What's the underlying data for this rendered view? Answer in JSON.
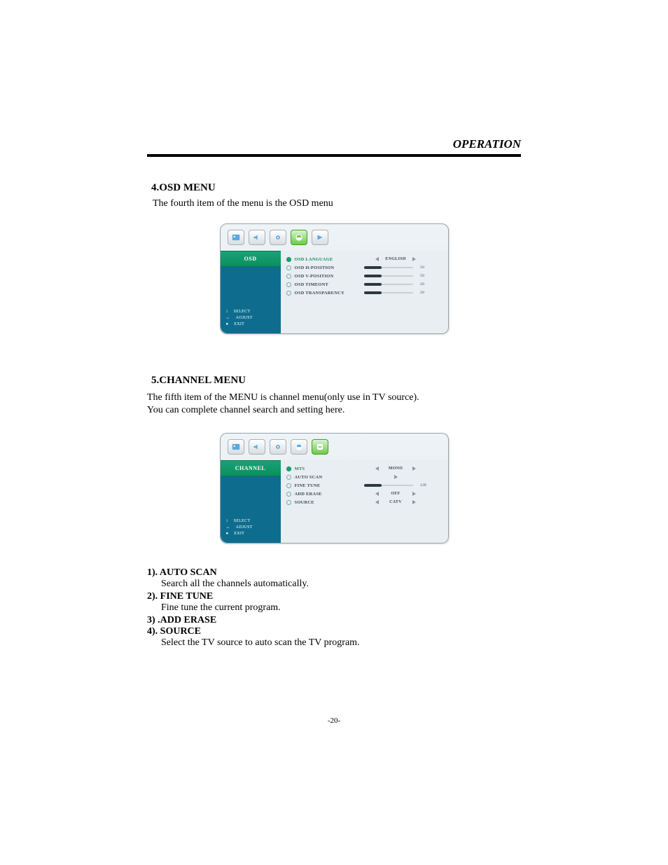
{
  "header": {
    "title": "OPERATION"
  },
  "page_number": "-20-",
  "section4": {
    "title": "4.OSD MENU",
    "text": "The fourth item of the menu is the OSD menu",
    "menu": {
      "side_title": "OSD",
      "hints": [
        "SELECT",
        "AOJUST",
        "EXIT"
      ],
      "items": [
        {
          "label": "OSD  LANGUAGE",
          "type": "enum",
          "value": "ENGLISH",
          "selected": true
        },
        {
          "label": "OSD  H-POSITION",
          "type": "slider",
          "value": "50"
        },
        {
          "label": "OSD  V-POSITION",
          "type": "slider",
          "value": "50"
        },
        {
          "label": "OSD  TIMEONT",
          "type": "slider",
          "value": "20"
        },
        {
          "label": "OSD  TRANSPARENCY",
          "type": "slider",
          "value": "20"
        }
      ]
    }
  },
  "section5": {
    "title": "5.CHANNEL MENU",
    "para1": "The fifth item of the MENU is channel menu(only use in TV source).",
    "para2": "You can complete channel search and setting here.",
    "menu": {
      "side_title": "CHANNEL",
      "hints": [
        "SELECT",
        "ADJUST",
        "EXIT"
      ],
      "items": [
        {
          "label": "MTS",
          "type": "enum",
          "value": "MONO",
          "selected": true
        },
        {
          "label": "AUTO SCAN",
          "type": "action"
        },
        {
          "label": "FINE TUNE",
          "type": "slider",
          "value": "128"
        },
        {
          "label": "ADD ERASE",
          "type": "enum",
          "value": "OFF"
        },
        {
          "label": "SOURCE",
          "type": "enum",
          "value": "CATV"
        }
      ]
    },
    "defs": [
      {
        "title": "1). AUTO  SCAN",
        "desc": "Search all the channels automatically."
      },
      {
        "title": "2). FINE TUNE",
        "desc": "Fine tune the current program."
      },
      {
        "title": "3) .ADD ERASE",
        "desc": ""
      },
      {
        "title": "4). SOURCE",
        "desc": "Select the TV source to auto scan the TV program."
      }
    ]
  }
}
